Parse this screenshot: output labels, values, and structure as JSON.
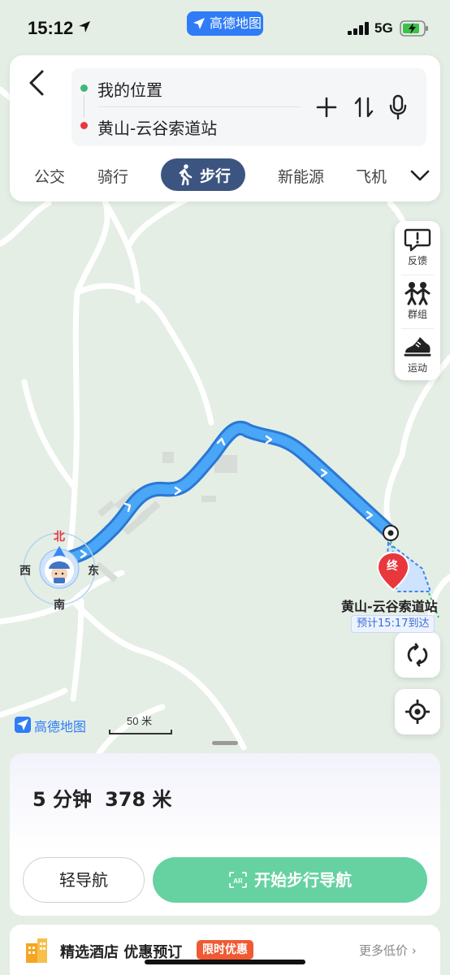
{
  "status_bar": {
    "time": "15:12",
    "app_badge": "高德地图",
    "network": "5G"
  },
  "search": {
    "origin": "我的位置",
    "destination": "黄山-云谷索道站",
    "icons": [
      "back-icon",
      "add-icon",
      "swap-icon",
      "mic-icon"
    ]
  },
  "modes": {
    "items": [
      "公交",
      "骑行",
      "步行",
      "新能源",
      "飞机"
    ],
    "active": "步行"
  },
  "tools": {
    "feedback": "反馈",
    "group": "群组",
    "sport": "运动"
  },
  "map": {
    "compass": {
      "north": "北",
      "south": "南",
      "east": "东",
      "west": "西"
    },
    "destination_marker": "终",
    "destination_name": "黄山-云谷索道站",
    "eta": "预计15:17到达",
    "logo": "高德地图",
    "scale": "50 米",
    "colors": {
      "route": "#3d9cf5",
      "route_border": "#2a78d4",
      "background": "#e5efe6",
      "road": "#ffffff"
    }
  },
  "summary": {
    "duration": "5 分钟",
    "distance": "378 米"
  },
  "actions": {
    "lite_nav": "轻导航",
    "start_nav": "开始步行导航",
    "start_color": "#66d1a1"
  },
  "hotel": {
    "title": "精选酒店 优惠预订",
    "tag": "限时优惠",
    "more": "更多低价 ›"
  }
}
